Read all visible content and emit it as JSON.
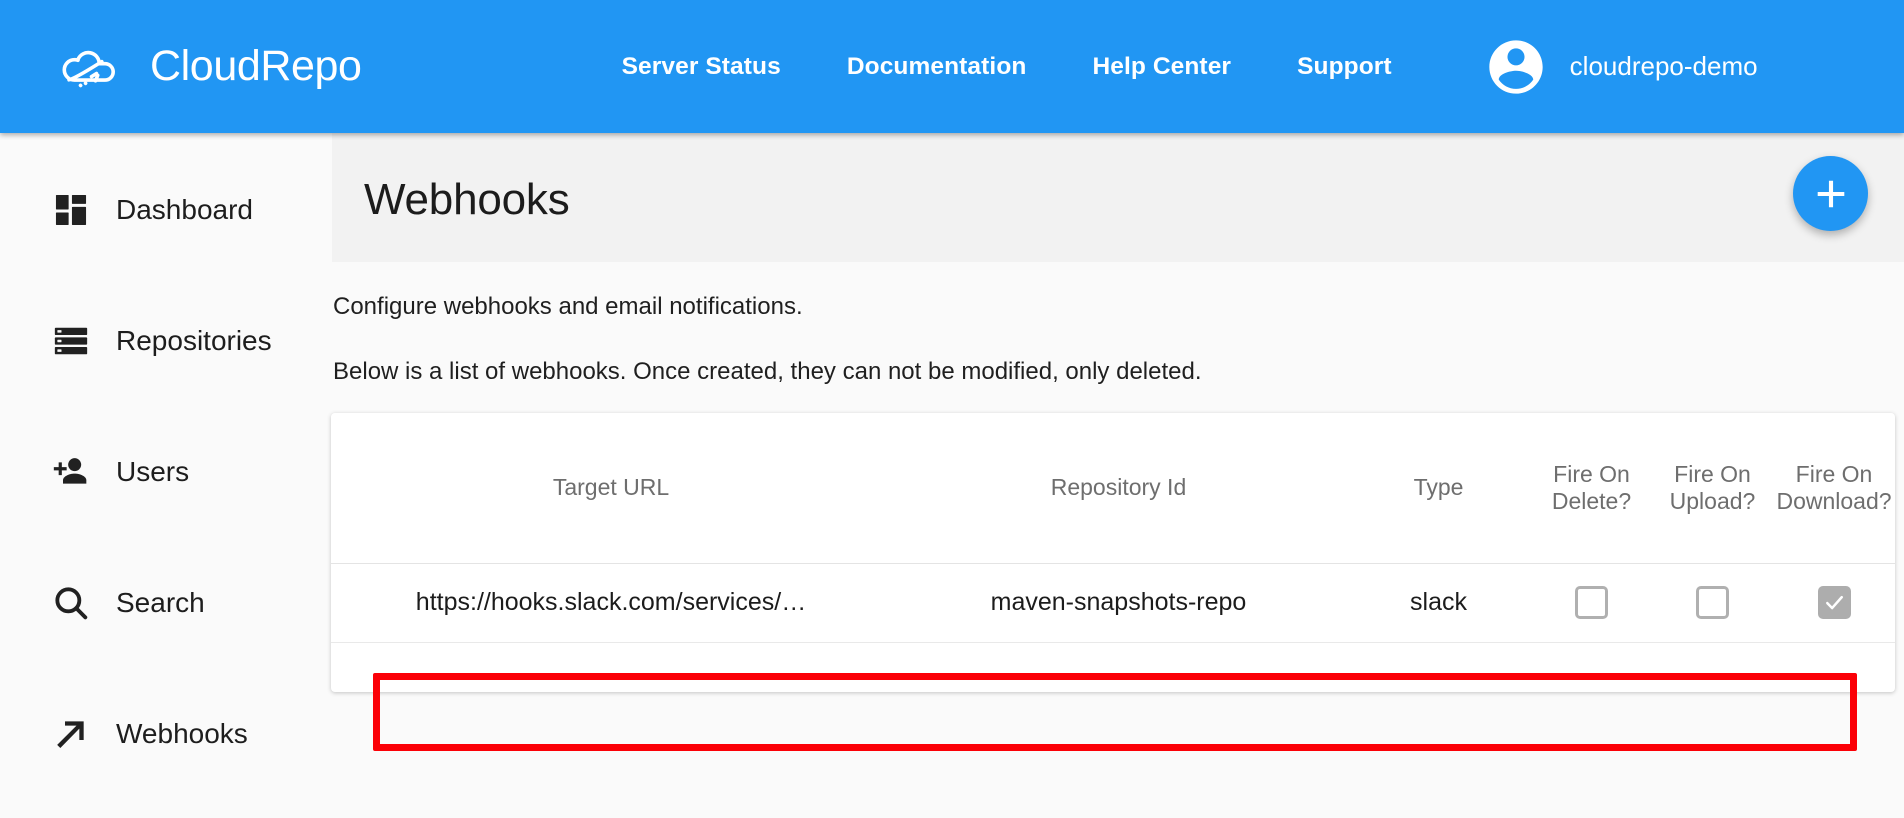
{
  "topnav": {
    "brand": "CloudRepo",
    "brand_logo_icon": "cloud-logo-icon",
    "links": [
      {
        "label": "Server Status"
      },
      {
        "label": "Documentation"
      },
      {
        "label": "Help Center"
      },
      {
        "label": "Support"
      }
    ],
    "account": {
      "name": "cloudrepo-demo",
      "avatar_icon": "account-circle-icon"
    },
    "background_color": "#2196f3"
  },
  "sidebar": {
    "items": [
      {
        "label": "Dashboard",
        "icon": "dashboard-grid-icon"
      },
      {
        "label": "Repositories",
        "icon": "storage-stack-icon"
      },
      {
        "label": "Users",
        "icon": "person-add-icon"
      },
      {
        "label": "Search",
        "icon": "search-magnifier-icon"
      },
      {
        "label": "Webhooks",
        "icon": "arrow-north-east-icon"
      }
    ]
  },
  "page": {
    "title": "Webhooks",
    "add_button": {
      "label": "+",
      "icon": "plus-icon",
      "color": "#2196f3"
    },
    "paragraphs": [
      "Configure webhooks and email notifications.",
      "Below is a list of webhooks. Once created, they can not be modified, only deleted."
    ]
  },
  "table": {
    "columns": [
      "Target URL",
      "Repository Id",
      "Type",
      "Fire On Delete?",
      "Fire On Upload?",
      "Fire On Download?"
    ],
    "rows": [
      {
        "target_url": "https://hooks.slack.com/services/…",
        "repository_id": "maven-snapshots-repo",
        "type": "slack",
        "fire_on_delete": false,
        "fire_on_upload": false,
        "fire_on_download": true,
        "highlighted": true
      }
    ],
    "highlight_color": "#fb0007"
  }
}
